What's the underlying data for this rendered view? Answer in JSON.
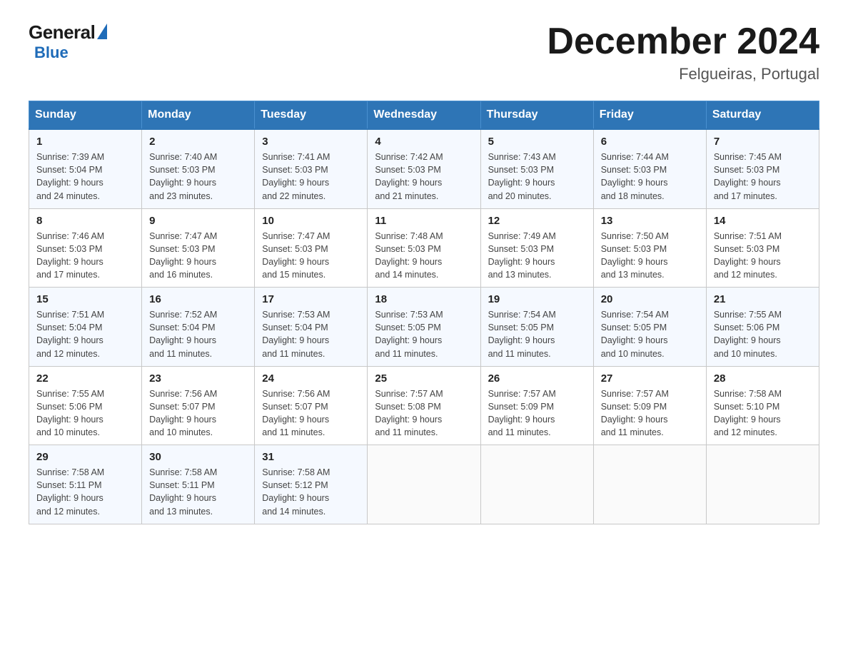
{
  "header": {
    "logo_general": "General",
    "logo_blue": "Blue",
    "main_title": "December 2024",
    "subtitle": "Felgueiras, Portugal"
  },
  "calendar": {
    "days_of_week": [
      "Sunday",
      "Monday",
      "Tuesday",
      "Wednesday",
      "Thursday",
      "Friday",
      "Saturday"
    ],
    "weeks": [
      [
        {
          "day": "1",
          "sunrise": "7:39 AM",
          "sunset": "5:04 PM",
          "daylight": "9 hours and 24 minutes."
        },
        {
          "day": "2",
          "sunrise": "7:40 AM",
          "sunset": "5:03 PM",
          "daylight": "9 hours and 23 minutes."
        },
        {
          "day": "3",
          "sunrise": "7:41 AM",
          "sunset": "5:03 PM",
          "daylight": "9 hours and 22 minutes."
        },
        {
          "day": "4",
          "sunrise": "7:42 AM",
          "sunset": "5:03 PM",
          "daylight": "9 hours and 21 minutes."
        },
        {
          "day": "5",
          "sunrise": "7:43 AM",
          "sunset": "5:03 PM",
          "daylight": "9 hours and 20 minutes."
        },
        {
          "day": "6",
          "sunrise": "7:44 AM",
          "sunset": "5:03 PM",
          "daylight": "9 hours and 18 minutes."
        },
        {
          "day": "7",
          "sunrise": "7:45 AM",
          "sunset": "5:03 PM",
          "daylight": "9 hours and 17 minutes."
        }
      ],
      [
        {
          "day": "8",
          "sunrise": "7:46 AM",
          "sunset": "5:03 PM",
          "daylight": "9 hours and 17 minutes."
        },
        {
          "day": "9",
          "sunrise": "7:47 AM",
          "sunset": "5:03 PM",
          "daylight": "9 hours and 16 minutes."
        },
        {
          "day": "10",
          "sunrise": "7:47 AM",
          "sunset": "5:03 PM",
          "daylight": "9 hours and 15 minutes."
        },
        {
          "day": "11",
          "sunrise": "7:48 AM",
          "sunset": "5:03 PM",
          "daylight": "9 hours and 14 minutes."
        },
        {
          "day": "12",
          "sunrise": "7:49 AM",
          "sunset": "5:03 PM",
          "daylight": "9 hours and 13 minutes."
        },
        {
          "day": "13",
          "sunrise": "7:50 AM",
          "sunset": "5:03 PM",
          "daylight": "9 hours and 13 minutes."
        },
        {
          "day": "14",
          "sunrise": "7:51 AM",
          "sunset": "5:03 PM",
          "daylight": "9 hours and 12 minutes."
        }
      ],
      [
        {
          "day": "15",
          "sunrise": "7:51 AM",
          "sunset": "5:04 PM",
          "daylight": "9 hours and 12 minutes."
        },
        {
          "day": "16",
          "sunrise": "7:52 AM",
          "sunset": "5:04 PM",
          "daylight": "9 hours and 11 minutes."
        },
        {
          "day": "17",
          "sunrise": "7:53 AM",
          "sunset": "5:04 PM",
          "daylight": "9 hours and 11 minutes."
        },
        {
          "day": "18",
          "sunrise": "7:53 AM",
          "sunset": "5:05 PM",
          "daylight": "9 hours and 11 minutes."
        },
        {
          "day": "19",
          "sunrise": "7:54 AM",
          "sunset": "5:05 PM",
          "daylight": "9 hours and 11 minutes."
        },
        {
          "day": "20",
          "sunrise": "7:54 AM",
          "sunset": "5:05 PM",
          "daylight": "9 hours and 10 minutes."
        },
        {
          "day": "21",
          "sunrise": "7:55 AM",
          "sunset": "5:06 PM",
          "daylight": "9 hours and 10 minutes."
        }
      ],
      [
        {
          "day": "22",
          "sunrise": "7:55 AM",
          "sunset": "5:06 PM",
          "daylight": "9 hours and 10 minutes."
        },
        {
          "day": "23",
          "sunrise": "7:56 AM",
          "sunset": "5:07 PM",
          "daylight": "9 hours and 10 minutes."
        },
        {
          "day": "24",
          "sunrise": "7:56 AM",
          "sunset": "5:07 PM",
          "daylight": "9 hours and 11 minutes."
        },
        {
          "day": "25",
          "sunrise": "7:57 AM",
          "sunset": "5:08 PM",
          "daylight": "9 hours and 11 minutes."
        },
        {
          "day": "26",
          "sunrise": "7:57 AM",
          "sunset": "5:09 PM",
          "daylight": "9 hours and 11 minutes."
        },
        {
          "day": "27",
          "sunrise": "7:57 AM",
          "sunset": "5:09 PM",
          "daylight": "9 hours and 11 minutes."
        },
        {
          "day": "28",
          "sunrise": "7:58 AM",
          "sunset": "5:10 PM",
          "daylight": "9 hours and 12 minutes."
        }
      ],
      [
        {
          "day": "29",
          "sunrise": "7:58 AM",
          "sunset": "5:11 PM",
          "daylight": "9 hours and 12 minutes."
        },
        {
          "day": "30",
          "sunrise": "7:58 AM",
          "sunset": "5:11 PM",
          "daylight": "9 hours and 13 minutes."
        },
        {
          "day": "31",
          "sunrise": "7:58 AM",
          "sunset": "5:12 PM",
          "daylight": "9 hours and 14 minutes."
        },
        null,
        null,
        null,
        null
      ]
    ],
    "labels": {
      "sunrise": "Sunrise:",
      "sunset": "Sunset:",
      "daylight": "Daylight:"
    }
  }
}
